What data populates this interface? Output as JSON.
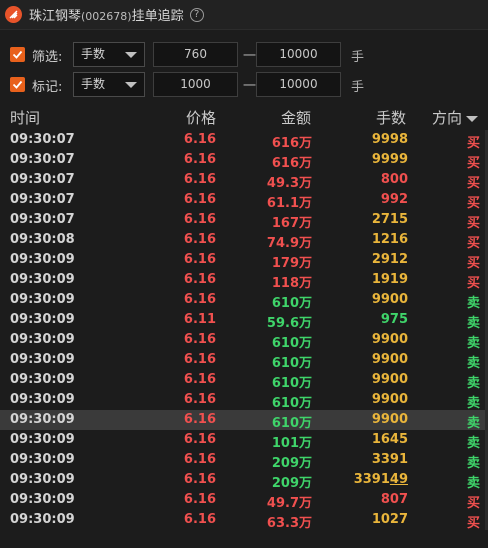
{
  "title": {
    "name": "珠江钢琴",
    "code": "(002678)",
    "suffix": "挂单追踪",
    "help": "?"
  },
  "filters": [
    {
      "label": "筛选:",
      "checked": true,
      "select": "手数",
      "min": "760",
      "dash": "一",
      "max": "10000",
      "unit": "手"
    },
    {
      "label": "标记:",
      "checked": true,
      "select": "手数",
      "min": "1000",
      "dash": "一",
      "max": "10000",
      "unit": "手"
    }
  ],
  "columns": {
    "time": "时间",
    "price": "价格",
    "amount": "金额",
    "qty": "手数",
    "direction": "方向"
  },
  "colors": {
    "buy": "#f0504f",
    "sell": "#3fd46a",
    "qty": "#e9b53b",
    "checkbox": "#e8611c"
  },
  "rows": [
    {
      "time": "09:30:07",
      "price": "6.16",
      "price_color": "red",
      "amount": "616万",
      "amount_color": "red",
      "qty": "9998",
      "dir": "买",
      "dir_color": "red"
    },
    {
      "time": "09:30:07",
      "price": "6.16",
      "price_color": "red",
      "amount": "616万",
      "amount_color": "red",
      "qty": "9999",
      "dir": "买",
      "dir_color": "red"
    },
    {
      "time": "09:30:07",
      "price": "6.16",
      "price_color": "red",
      "amount": "49.3万",
      "amount_color": "red",
      "qty": "800",
      "qty_color": "red",
      "dir": "买",
      "dir_color": "red"
    },
    {
      "time": "09:30:07",
      "price": "6.16",
      "price_color": "red",
      "amount": "61.1万",
      "amount_color": "red",
      "qty": "992",
      "qty_color": "red",
      "dir": "买",
      "dir_color": "red"
    },
    {
      "time": "09:30:07",
      "price": "6.16",
      "price_color": "red",
      "amount": "167万",
      "amount_color": "red",
      "qty": "2715",
      "dir": "买",
      "dir_color": "red"
    },
    {
      "time": "09:30:08",
      "price": "6.16",
      "price_color": "red",
      "amount": "74.9万",
      "amount_color": "red",
      "qty": "1216",
      "dir": "买",
      "dir_color": "red"
    },
    {
      "time": "09:30:09",
      "price": "6.16",
      "price_color": "red",
      "amount": "179万",
      "amount_color": "red",
      "qty": "2912",
      "dir": "买",
      "dir_color": "red"
    },
    {
      "time": "09:30:09",
      "price": "6.16",
      "price_color": "red",
      "amount": "118万",
      "amount_color": "red",
      "qty": "1919",
      "dir": "买",
      "dir_color": "red"
    },
    {
      "time": "09:30:09",
      "price": "6.16",
      "price_color": "red",
      "amount": "610万",
      "amount_color": "green",
      "qty": "9900",
      "dir": "卖",
      "dir_color": "green"
    },
    {
      "time": "09:30:09",
      "price": "6.11",
      "price_color": "red",
      "amount": "59.6万",
      "amount_color": "green",
      "qty": "975",
      "qty_color": "green",
      "dir": "卖",
      "dir_color": "green"
    },
    {
      "time": "09:30:09",
      "price": "6.16",
      "price_color": "red",
      "amount": "610万",
      "amount_color": "green",
      "qty": "9900",
      "dir": "卖",
      "dir_color": "green"
    },
    {
      "time": "09:30:09",
      "price": "6.16",
      "price_color": "red",
      "amount": "610万",
      "amount_color": "green",
      "qty": "9900",
      "dir": "卖",
      "dir_color": "green"
    },
    {
      "time": "09:30:09",
      "price": "6.16",
      "price_color": "red",
      "amount": "610万",
      "amount_color": "green",
      "qty": "9900",
      "dir": "卖",
      "dir_color": "green"
    },
    {
      "time": "09:30:09",
      "price": "6.16",
      "price_color": "red",
      "amount": "610万",
      "amount_color": "green",
      "qty": "9900",
      "dir": "卖",
      "dir_color": "green"
    },
    {
      "time": "09:30:09",
      "price": "6.16",
      "price_color": "red",
      "amount": "610万",
      "amount_color": "green",
      "qty": "9900",
      "dir": "卖",
      "dir_color": "green",
      "selected": true
    },
    {
      "time": "09:30:09",
      "price": "6.16",
      "price_color": "red",
      "amount": "101万",
      "amount_color": "green",
      "qty": "1645",
      "dir": "卖",
      "dir_color": "green"
    },
    {
      "time": "09:30:09",
      "price": "6.16",
      "price_color": "red",
      "amount": "209万",
      "amount_color": "green",
      "qty": "3391",
      "dir": "卖",
      "dir_color": "green"
    },
    {
      "time": "09:30:09",
      "price": "6.16",
      "price_color": "red",
      "amount": "209万",
      "amount_color": "green",
      "qty": "3391",
      "qty_hover": "49",
      "dir": "卖",
      "dir_color": "green"
    },
    {
      "time": "09:30:09",
      "price": "6.16",
      "price_color": "red",
      "amount": "49.7万",
      "amount_color": "red",
      "qty": "807",
      "qty_color": "red",
      "dir": "买",
      "dir_color": "red"
    },
    {
      "time": "09:30:09",
      "price": "6.16",
      "price_color": "red",
      "amount": "63.3万",
      "amount_color": "red",
      "qty": "1027",
      "dir": "买",
      "dir_color": "red"
    }
  ]
}
